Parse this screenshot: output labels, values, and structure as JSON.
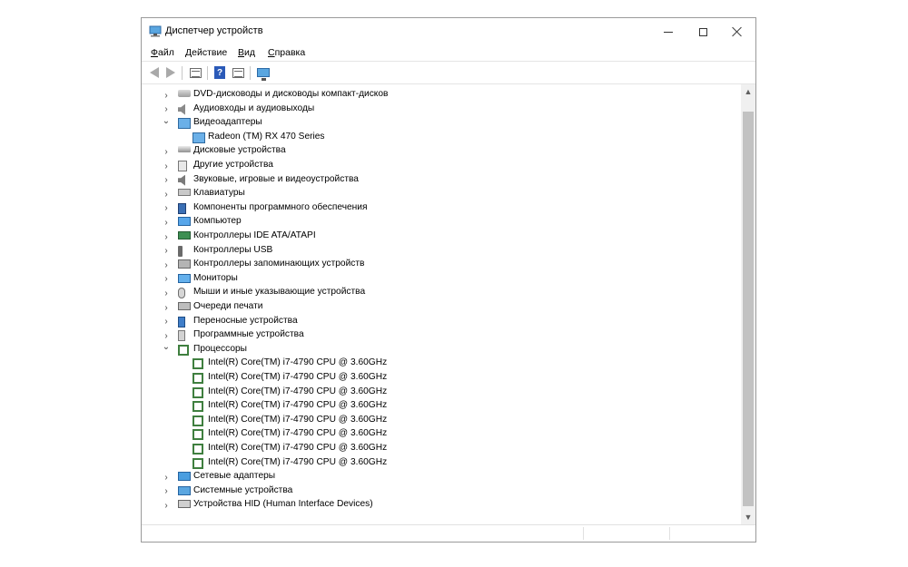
{
  "window": {
    "title": "Диспетчер устройств"
  },
  "menu": [
    "Файл",
    "Действие",
    "Вид",
    "Справка"
  ],
  "toolbar": {
    "buttons": [
      "back-icon",
      "forward-icon",
      "properties-icon",
      "help-icon",
      "show-hidden-icon",
      "monitor-icon"
    ]
  },
  "tree": {
    "items": [
      {
        "label": "DVD-дисководы и дисководы компакт-дисков",
        "icon": "dvd-drive-icon",
        "expanded": false,
        "level": 0
      },
      {
        "label": "Аудиовходы и аудиовыходы",
        "icon": "audio-io-icon",
        "expanded": false,
        "level": 0
      },
      {
        "label": "Видеоадаптеры",
        "icon": "display-adapter-icon",
        "expanded": true,
        "level": 0
      },
      {
        "label": "Radeon (TM) RX 470 Series",
        "icon": "display-adapter-icon",
        "level": 1
      },
      {
        "label": "Дисковые устройства",
        "icon": "disk-drive-icon",
        "expanded": false,
        "level": 0
      },
      {
        "label": "Другие устройства",
        "icon": "unknown-device-icon",
        "expanded": false,
        "level": 0
      },
      {
        "label": "Звуковые, игровые и видеоустройства",
        "icon": "sound-device-icon",
        "expanded": false,
        "level": 0
      },
      {
        "label": "Клавиатуры",
        "icon": "keyboard-icon",
        "expanded": false,
        "level": 0
      },
      {
        "label": "Компоненты программного обеспечения",
        "icon": "software-component-icon",
        "expanded": false,
        "level": 0
      },
      {
        "label": "Компьютер",
        "icon": "computer-icon",
        "expanded": false,
        "level": 0
      },
      {
        "label": "Контроллеры IDE ATA/ATAPI",
        "icon": "ide-controller-icon",
        "expanded": false,
        "level": 0
      },
      {
        "label": "Контроллеры USB",
        "icon": "usb-icon",
        "expanded": false,
        "level": 0
      },
      {
        "label": "Контроллеры запоминающих устройств",
        "icon": "storage-controller-icon",
        "expanded": false,
        "level": 0
      },
      {
        "label": "Мониторы",
        "icon": "monitor-icon",
        "expanded": false,
        "level": 0
      },
      {
        "label": "Мыши и иные указывающие устройства",
        "icon": "mouse-icon",
        "expanded": false,
        "level": 0
      },
      {
        "label": "Очереди печати",
        "icon": "printer-icon",
        "expanded": false,
        "level": 0
      },
      {
        "label": "Переносные устройства",
        "icon": "portable-device-icon",
        "expanded": false,
        "level": 0
      },
      {
        "label": "Программные устройства",
        "icon": "software-device-icon",
        "expanded": false,
        "level": 0
      },
      {
        "label": "Процессоры",
        "icon": "processor-icon",
        "expanded": true,
        "level": 0
      },
      {
        "label": "Intel(R) Core(TM) i7-4790 CPU @ 3.60GHz",
        "icon": "processor-icon",
        "level": 1
      },
      {
        "label": "Intel(R) Core(TM) i7-4790 CPU @ 3.60GHz",
        "icon": "processor-icon",
        "level": 1
      },
      {
        "label": "Intel(R) Core(TM) i7-4790 CPU @ 3.60GHz",
        "icon": "processor-icon",
        "level": 1
      },
      {
        "label": "Intel(R) Core(TM) i7-4790 CPU @ 3.60GHz",
        "icon": "processor-icon",
        "level": 1
      },
      {
        "label": "Intel(R) Core(TM) i7-4790 CPU @ 3.60GHz",
        "icon": "processor-icon",
        "level": 1
      },
      {
        "label": "Intel(R) Core(TM) i7-4790 CPU @ 3.60GHz",
        "icon": "processor-icon",
        "level": 1
      },
      {
        "label": "Intel(R) Core(TM) i7-4790 CPU @ 3.60GHz",
        "icon": "processor-icon",
        "level": 1
      },
      {
        "label": "Intel(R) Core(TM) i7-4790 CPU @ 3.60GHz",
        "icon": "processor-icon",
        "level": 1
      },
      {
        "label": "Сетевые адаптеры",
        "icon": "network-adapter-icon",
        "expanded": false,
        "level": 0
      },
      {
        "label": "Системные устройства",
        "icon": "system-device-icon",
        "expanded": false,
        "level": 0
      },
      {
        "label": "Устройства HID (Human Interface Devices)",
        "icon": "hid-icon",
        "expanded": false,
        "level": 0
      }
    ]
  }
}
